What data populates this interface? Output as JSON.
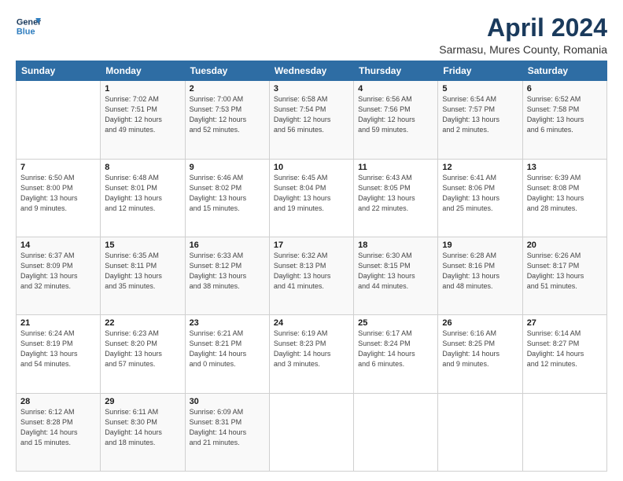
{
  "logo": {
    "line1": "General",
    "line2": "Blue"
  },
  "title": "April 2024",
  "location": "Sarmasu, Mures County, Romania",
  "headers": [
    "Sunday",
    "Monday",
    "Tuesday",
    "Wednesday",
    "Thursday",
    "Friday",
    "Saturday"
  ],
  "weeks": [
    [
      {
        "num": "",
        "detail": ""
      },
      {
        "num": "1",
        "detail": "Sunrise: 7:02 AM\nSunset: 7:51 PM\nDaylight: 12 hours\nand 49 minutes."
      },
      {
        "num": "2",
        "detail": "Sunrise: 7:00 AM\nSunset: 7:53 PM\nDaylight: 12 hours\nand 52 minutes."
      },
      {
        "num": "3",
        "detail": "Sunrise: 6:58 AM\nSunset: 7:54 PM\nDaylight: 12 hours\nand 56 minutes."
      },
      {
        "num": "4",
        "detail": "Sunrise: 6:56 AM\nSunset: 7:56 PM\nDaylight: 12 hours\nand 59 minutes."
      },
      {
        "num": "5",
        "detail": "Sunrise: 6:54 AM\nSunset: 7:57 PM\nDaylight: 13 hours\nand 2 minutes."
      },
      {
        "num": "6",
        "detail": "Sunrise: 6:52 AM\nSunset: 7:58 PM\nDaylight: 13 hours\nand 6 minutes."
      }
    ],
    [
      {
        "num": "7",
        "detail": "Sunrise: 6:50 AM\nSunset: 8:00 PM\nDaylight: 13 hours\nand 9 minutes."
      },
      {
        "num": "8",
        "detail": "Sunrise: 6:48 AM\nSunset: 8:01 PM\nDaylight: 13 hours\nand 12 minutes."
      },
      {
        "num": "9",
        "detail": "Sunrise: 6:46 AM\nSunset: 8:02 PM\nDaylight: 13 hours\nand 15 minutes."
      },
      {
        "num": "10",
        "detail": "Sunrise: 6:45 AM\nSunset: 8:04 PM\nDaylight: 13 hours\nand 19 minutes."
      },
      {
        "num": "11",
        "detail": "Sunrise: 6:43 AM\nSunset: 8:05 PM\nDaylight: 13 hours\nand 22 minutes."
      },
      {
        "num": "12",
        "detail": "Sunrise: 6:41 AM\nSunset: 8:06 PM\nDaylight: 13 hours\nand 25 minutes."
      },
      {
        "num": "13",
        "detail": "Sunrise: 6:39 AM\nSunset: 8:08 PM\nDaylight: 13 hours\nand 28 minutes."
      }
    ],
    [
      {
        "num": "14",
        "detail": "Sunrise: 6:37 AM\nSunset: 8:09 PM\nDaylight: 13 hours\nand 32 minutes."
      },
      {
        "num": "15",
        "detail": "Sunrise: 6:35 AM\nSunset: 8:11 PM\nDaylight: 13 hours\nand 35 minutes."
      },
      {
        "num": "16",
        "detail": "Sunrise: 6:33 AM\nSunset: 8:12 PM\nDaylight: 13 hours\nand 38 minutes."
      },
      {
        "num": "17",
        "detail": "Sunrise: 6:32 AM\nSunset: 8:13 PM\nDaylight: 13 hours\nand 41 minutes."
      },
      {
        "num": "18",
        "detail": "Sunrise: 6:30 AM\nSunset: 8:15 PM\nDaylight: 13 hours\nand 44 minutes."
      },
      {
        "num": "19",
        "detail": "Sunrise: 6:28 AM\nSunset: 8:16 PM\nDaylight: 13 hours\nand 48 minutes."
      },
      {
        "num": "20",
        "detail": "Sunrise: 6:26 AM\nSunset: 8:17 PM\nDaylight: 13 hours\nand 51 minutes."
      }
    ],
    [
      {
        "num": "21",
        "detail": "Sunrise: 6:24 AM\nSunset: 8:19 PM\nDaylight: 13 hours\nand 54 minutes."
      },
      {
        "num": "22",
        "detail": "Sunrise: 6:23 AM\nSunset: 8:20 PM\nDaylight: 13 hours\nand 57 minutes."
      },
      {
        "num": "23",
        "detail": "Sunrise: 6:21 AM\nSunset: 8:21 PM\nDaylight: 14 hours\nand 0 minutes."
      },
      {
        "num": "24",
        "detail": "Sunrise: 6:19 AM\nSunset: 8:23 PM\nDaylight: 14 hours\nand 3 minutes."
      },
      {
        "num": "25",
        "detail": "Sunrise: 6:17 AM\nSunset: 8:24 PM\nDaylight: 14 hours\nand 6 minutes."
      },
      {
        "num": "26",
        "detail": "Sunrise: 6:16 AM\nSunset: 8:25 PM\nDaylight: 14 hours\nand 9 minutes."
      },
      {
        "num": "27",
        "detail": "Sunrise: 6:14 AM\nSunset: 8:27 PM\nDaylight: 14 hours\nand 12 minutes."
      }
    ],
    [
      {
        "num": "28",
        "detail": "Sunrise: 6:12 AM\nSunset: 8:28 PM\nDaylight: 14 hours\nand 15 minutes."
      },
      {
        "num": "29",
        "detail": "Sunrise: 6:11 AM\nSunset: 8:30 PM\nDaylight: 14 hours\nand 18 minutes."
      },
      {
        "num": "30",
        "detail": "Sunrise: 6:09 AM\nSunset: 8:31 PM\nDaylight: 14 hours\nand 21 minutes."
      },
      {
        "num": "",
        "detail": ""
      },
      {
        "num": "",
        "detail": ""
      },
      {
        "num": "",
        "detail": ""
      },
      {
        "num": "",
        "detail": ""
      }
    ]
  ]
}
